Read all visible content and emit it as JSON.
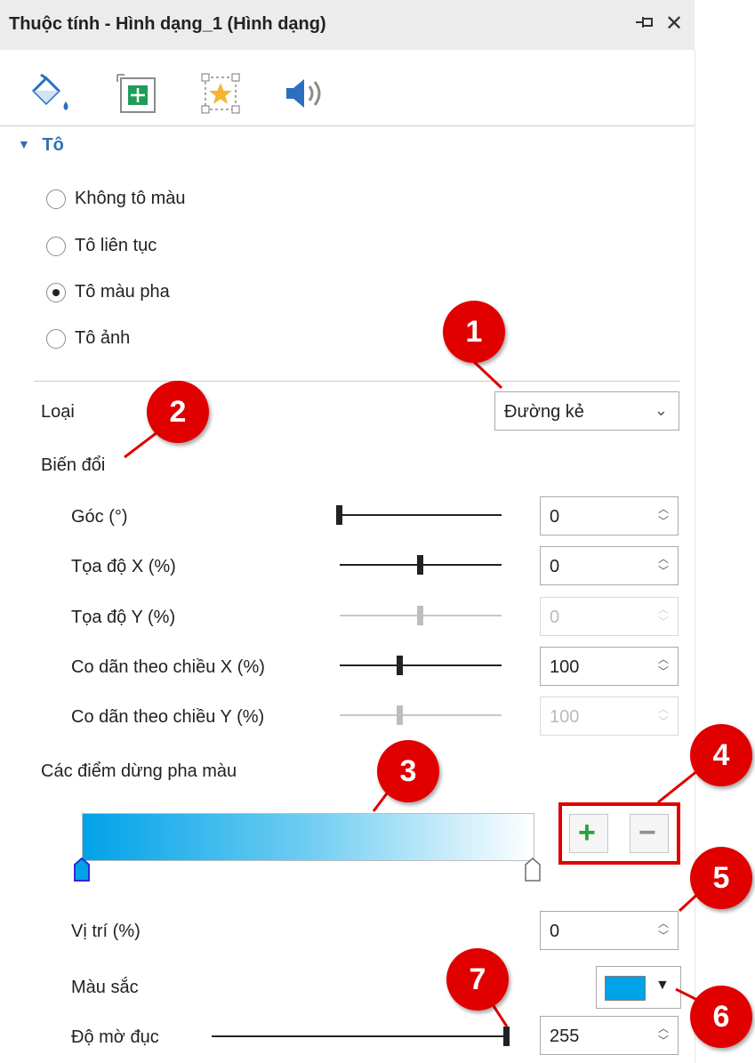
{
  "window": {
    "title": "Thuộc tính - Hình dạng_1 (Hình dạng)",
    "pin_icon": "pin-icon",
    "close_glyph": "✕"
  },
  "tabs": [
    {
      "icon": "paint-bucket-icon",
      "active": true
    },
    {
      "icon": "move-size-icon",
      "active": false
    },
    {
      "icon": "star-effect-icon",
      "active": false
    },
    {
      "icon": "speaker-sound-icon",
      "active": false
    }
  ],
  "fill_section": {
    "title": "Tô",
    "options": [
      {
        "label": "Không tô màu",
        "selected": false
      },
      {
        "label": "Tô liên tục",
        "selected": false
      },
      {
        "label": "Tô màu pha",
        "selected": true
      },
      {
        "label": "Tô ảnh",
        "selected": false
      }
    ],
    "type_label": "Loại",
    "type_value": "Đường kẻ",
    "transform_label": "Biến đổi",
    "rows": [
      {
        "label": "Góc (°)",
        "value": "0",
        "slider_fraction": 0.0,
        "enabled": true
      },
      {
        "label": "Tọa độ X (%)",
        "value": "0",
        "slider_fraction": 0.5,
        "enabled": true
      },
      {
        "label": "Tọa độ Y (%)",
        "value": "0",
        "slider_fraction": 0.5,
        "enabled": false
      },
      {
        "label": "Co dãn theo chiều X (%)",
        "value": "100",
        "slider_fraction": 0.37,
        "enabled": true
      },
      {
        "label": "Co dãn theo chiều Y (%)",
        "value": "100",
        "slider_fraction": 0.37,
        "enabled": false
      }
    ],
    "gradient_stops_label": "Các điểm dừng pha màu",
    "gradient_colors": [
      "#00a2e8",
      "#ffffff"
    ],
    "add_stop_glyph": "+",
    "remove_stop_glyph": "−",
    "position_label": "Vị trí (%)",
    "position_value": "0",
    "color_label": "Màu sắc",
    "color_value": "#00a2e8",
    "opacity_label": "Độ mờ đục",
    "opacity_value": "255",
    "opacity_fraction": 1.0
  },
  "callouts": [
    "1",
    "2",
    "3",
    "4",
    "5",
    "6",
    "7"
  ],
  "accent_color": "#e00000",
  "section_color": "#2f6fb3"
}
